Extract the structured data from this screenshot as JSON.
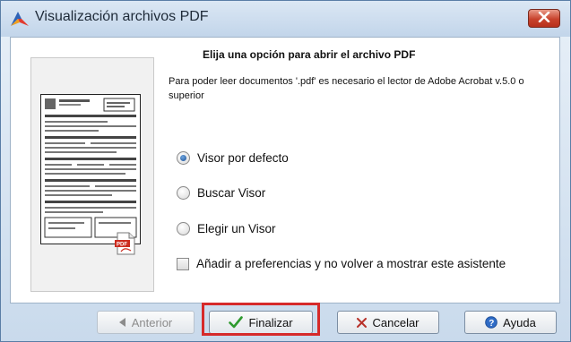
{
  "window": {
    "title": "Visualización archivos PDF"
  },
  "main": {
    "heading": "Elija una opción para abrir el archivo PDF",
    "description": "Para poder leer documentos '.pdf' es necesario el lector de Adobe Acrobat v.5.0 o superior",
    "options": [
      {
        "label": "Visor por defecto",
        "selected": true
      },
      {
        "label": "Buscar Visor",
        "selected": false
      },
      {
        "label": "Elegir un Visor",
        "selected": false
      }
    ],
    "checkbox": {
      "label": "Añadir a preferencias y no volver a mostrar este asistente",
      "checked": false
    }
  },
  "footer": {
    "previous_label": "Anterior",
    "finish_label": "Finalizar",
    "cancel_label": "Cancelar",
    "help_label": "Ayuda"
  },
  "colors": {
    "highlight": "#d62a2a",
    "finish_check": "#2e9a2e",
    "close_button": "#c8422c"
  },
  "icons": {
    "app": "arrow-logo-icon",
    "close": "close-icon",
    "previous": "triangle-left-icon",
    "finish": "checkmark-icon",
    "cancel": "cross-icon",
    "help": "question-icon",
    "file": "pdf-file-icon"
  }
}
